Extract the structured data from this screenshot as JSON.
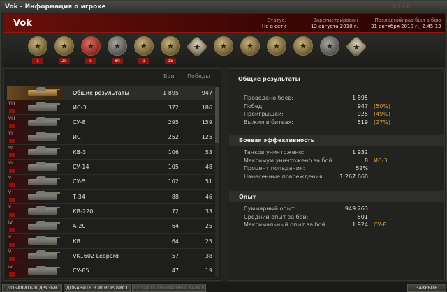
{
  "window": {
    "title": "Vok - Информация о игроке",
    "ghost_text": "0.7.4 K"
  },
  "header": {
    "nick": "Vok",
    "status_label": "Статус:",
    "status_value": "Не в сети",
    "registered_label": "Зарегистрирован",
    "registered_value": "13 августа 2010 г.",
    "last_battle_label": "Последний раз был в бою",
    "last_battle_value": "31 октября 2010 г., 2:45:13"
  },
  "medals": [
    {
      "icon": "tank-medal-icon",
      "count": "1",
      "style": "gold"
    },
    {
      "icon": "wreath-medal-icon",
      "count": "25",
      "style": "gold"
    },
    {
      "icon": "red-star-medal-icon",
      "count": "5",
      "style": "red"
    },
    {
      "icon": "shield-medal-icon",
      "count": "80",
      "style": "grey"
    },
    {
      "icon": "crossed-tank-medal-icon",
      "count": "1",
      "style": "gold"
    },
    {
      "icon": "gold-tank-medal-icon",
      "count": "15",
      "style": "gold"
    },
    {
      "icon": "silver-star-order-icon",
      "count": "",
      "style": "star"
    },
    {
      "icon": "orange-cross-order-icon",
      "count": "",
      "style": "gold"
    },
    {
      "icon": "bronze-cross-order-icon",
      "count": "",
      "style": "gold"
    },
    {
      "icon": "gold-star-order-icon",
      "count": "",
      "style": "gold"
    },
    {
      "icon": "portrait-medal-icon",
      "count": "",
      "style": "gold"
    },
    {
      "icon": "portrait-medal-icon-2",
      "count": "",
      "style": "grey"
    },
    {
      "icon": "star-order-icon",
      "count": "",
      "style": "star"
    }
  ],
  "vehicles": {
    "col_battles": "Бои",
    "col_wins": "Победы",
    "rows": [
      {
        "tier": "",
        "name": "Общие результаты",
        "battles": "1 895",
        "wins": "947",
        "overall": true
      },
      {
        "tier": "VIII",
        "name": "ИС-3",
        "battles": "372",
        "wins": "186"
      },
      {
        "tier": "VIII",
        "name": "СУ-8",
        "battles": "295",
        "wins": "159"
      },
      {
        "tier": "VII",
        "name": "ИС",
        "battles": "252",
        "wins": "125"
      },
      {
        "tier": "VI",
        "name": "КВ-3",
        "battles": "106",
        "wins": "53"
      },
      {
        "tier": "VI",
        "name": "СУ-14",
        "battles": "105",
        "wins": "48"
      },
      {
        "tier": "V",
        "name": "СУ-5",
        "battles": "102",
        "wins": "51"
      },
      {
        "tier": "V",
        "name": "Т-34",
        "battles": "88",
        "wins": "46"
      },
      {
        "tier": "V",
        "name": "КВ-220",
        "battles": "72",
        "wins": "33"
      },
      {
        "tier": "IV",
        "name": "А-20",
        "battles": "64",
        "wins": "25"
      },
      {
        "tier": "V",
        "name": "КВ",
        "battles": "64",
        "wins": "25"
      },
      {
        "tier": "V",
        "name": "VK1602 Leopard",
        "battles": "57",
        "wins": "38"
      },
      {
        "tier": "IV",
        "name": "СУ-85",
        "battles": "47",
        "wins": "19"
      }
    ]
  },
  "stats": {
    "title": "Общие результаты",
    "general": [
      {
        "label": "Проведено боев:",
        "value": "1 895",
        "pct": ""
      },
      {
        "label": "Побед:",
        "value": "947",
        "pct": "(50%)"
      },
      {
        "label": "Проигрышей:",
        "value": "925",
        "pct": "(49%)"
      },
      {
        "label": "Выжил в битвах:",
        "value": "519",
        "pct": "(27%)"
      }
    ],
    "combat_title": "Боевая эффективность",
    "combat": [
      {
        "label": "Танков уничтожено:",
        "value": "1 932",
        "pct": ""
      },
      {
        "label": "Максимум уничтожено за бой:",
        "value": "8",
        "pct": "ИС-3"
      },
      {
        "label": "Процент попадания:",
        "value": "52%",
        "pct": ""
      },
      {
        "label": "Нанесенные повреждения:",
        "value": "1 267 660",
        "pct": ""
      }
    ],
    "exp_title": "Опыт",
    "exp": [
      {
        "label": "Суммарный опыт:",
        "value": "949 263",
        "pct": ""
      },
      {
        "label": "Средний опыт за бой:",
        "value": "501",
        "pct": ""
      },
      {
        "label": "Максимальный опыт за бой:",
        "value": "1 924",
        "pct": "СУ-8"
      }
    ]
  },
  "footer": {
    "add_friend": "ДОБАВИТЬ В ДРУЗЬЯ",
    "add_ignore": "ДОБАВИТЬ В ИГНОР-ЛИСТ",
    "private_channel": "СОЗДАТЬ ПРИВАТНЫЙ КАНАЛ",
    "close": "ЗАКРЫТЬ"
  }
}
